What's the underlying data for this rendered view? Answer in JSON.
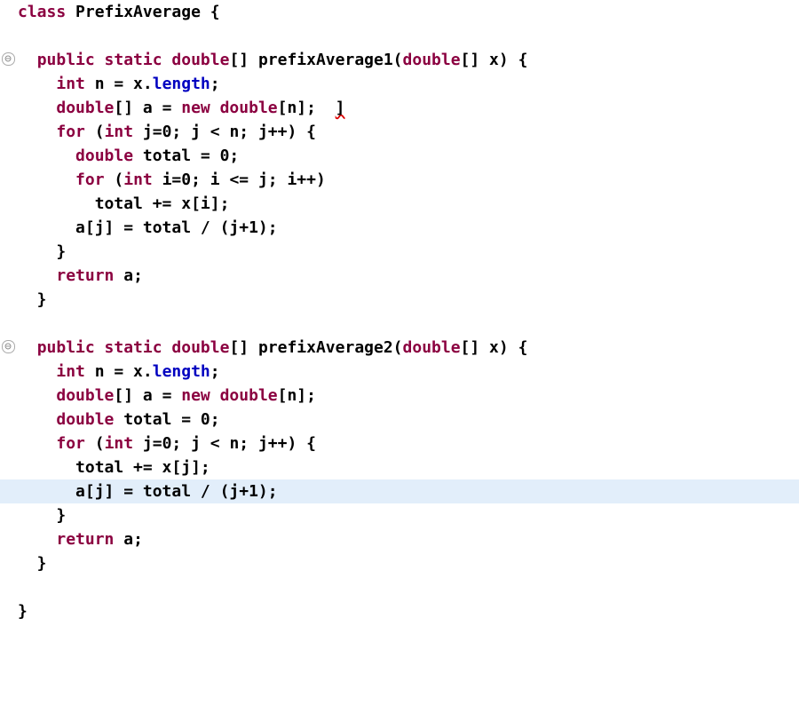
{
  "language": "Java",
  "class_name": "PrefixAverage",
  "fold_glyph": "⊖",
  "error_marker_text": "]",
  "code": {
    "lines": [
      {
        "gutter": "",
        "highlight": false,
        "html": "<span class=\"kw\">class</span> PrefixAverage {"
      },
      {
        "gutter": "",
        "highlight": false,
        "html": ""
      },
      {
        "gutter": "fold",
        "highlight": false,
        "html": "  <span class=\"kw\">public static double</span>[] prefixAverage1(<span class=\"kw\">double</span>[] x) {"
      },
      {
        "gutter": "",
        "highlight": false,
        "html": "    <span class=\"kw\">int</span> n = x.<span class=\"field\">length</span>;"
      },
      {
        "gutter": "",
        "highlight": false,
        "html": "    <span class=\"kw\">double</span>[] a = <span class=\"kw\">new double</span>[n];  <span class=\"err\">]</span>"
      },
      {
        "gutter": "",
        "highlight": false,
        "html": "    <span class=\"kw\">for</span> (<span class=\"kw\">int</span> j=0; j &lt; n; j++) {"
      },
      {
        "gutter": "",
        "highlight": false,
        "html": "      <span class=\"kw\">double</span> total = 0;"
      },
      {
        "gutter": "",
        "highlight": false,
        "html": "      <span class=\"kw\">for</span> (<span class=\"kw\">int</span> i=0; i &lt;= j; i++)"
      },
      {
        "gutter": "",
        "highlight": false,
        "html": "        total += x[i];"
      },
      {
        "gutter": "",
        "highlight": false,
        "html": "      a[j] = total / (j+1);"
      },
      {
        "gutter": "",
        "highlight": false,
        "html": "    }"
      },
      {
        "gutter": "",
        "highlight": false,
        "html": "    <span class=\"kw\">return</span> a;"
      },
      {
        "gutter": "",
        "highlight": false,
        "html": "  }"
      },
      {
        "gutter": "",
        "highlight": false,
        "html": ""
      },
      {
        "gutter": "fold",
        "highlight": false,
        "html": "  <span class=\"kw\">public static double</span>[] prefixAverage2(<span class=\"kw\">double</span>[] x) {"
      },
      {
        "gutter": "",
        "highlight": false,
        "html": "    <span class=\"kw\">int</span> n = x.<span class=\"field\">length</span>;"
      },
      {
        "gutter": "",
        "highlight": false,
        "html": "    <span class=\"kw\">double</span>[] a = <span class=\"kw\">new double</span>[n];"
      },
      {
        "gutter": "",
        "highlight": false,
        "html": "    <span class=\"kw\">double</span> total = 0;"
      },
      {
        "gutter": "",
        "highlight": false,
        "html": "    <span class=\"kw\">for</span> (<span class=\"kw\">int</span> j=0; j &lt; n; j++) {"
      },
      {
        "gutter": "",
        "highlight": false,
        "html": "      total += x[j];"
      },
      {
        "gutter": "",
        "highlight": true,
        "html": "      a[j] = total / (j+1);"
      },
      {
        "gutter": "",
        "highlight": false,
        "html": "    }"
      },
      {
        "gutter": "",
        "highlight": false,
        "html": "    <span class=\"kw\">return</span> a;"
      },
      {
        "gutter": "",
        "highlight": false,
        "html": "  }"
      },
      {
        "gutter": "",
        "highlight": false,
        "html": ""
      },
      {
        "gutter": "",
        "highlight": false,
        "html": "}"
      }
    ]
  }
}
